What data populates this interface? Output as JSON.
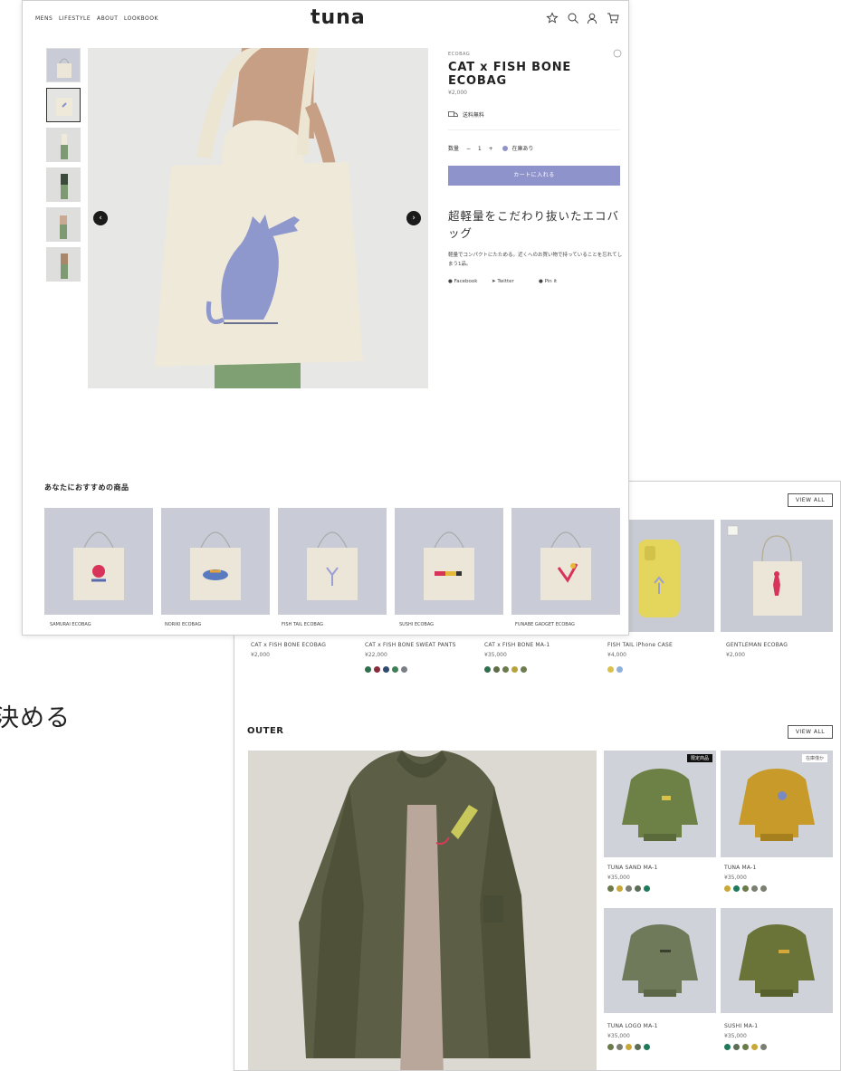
{
  "background_text": "決める",
  "front": {
    "nav": {
      "links": [
        "MENS",
        "LIFESTYLE",
        "ABOUT",
        "LOOKBOOK"
      ],
      "logo": "tuna"
    },
    "product": {
      "category": "ECOBAG",
      "title": "CAT x FISH BONE ECOBAG",
      "price": "¥2,000",
      "shipping": "送料無料",
      "qty_label": "数量",
      "qty_minus": "−",
      "qty_value": "1",
      "qty_plus": "+",
      "stock": "在庫あり",
      "cart_button": "カートに入れる",
      "headline": "超軽量をこだわり抜いたエコバッグ",
      "description": "軽量でコンパクトにたためる。近くへのお買い物で持っていることを忘れてしまう1品。",
      "share": [
        "Facebook",
        "Twitter",
        "Pin it"
      ]
    },
    "recommend": {
      "title": "あなたにおすすめの商品",
      "items": [
        "SAMURAI ECOBAG",
        "NORIKI ECOBAG",
        "FISH TAIL ECOBAG",
        "SUSHI ECOBAG",
        "FUNABE GADGET ECOBAG"
      ]
    }
  },
  "back": {
    "view_all": "VIEW ALL",
    "products": [
      {
        "name": "CAT x FISH BONE ECOBAG",
        "price": "¥2,000",
        "swatches": []
      },
      {
        "name": "CAT x FISH BONE SWEAT PANTS",
        "price": "¥22,000",
        "swatches": [
          "#2f6e4f",
          "#8a2b3a",
          "#2f4a6e",
          "#3f7f55",
          "#7a7f86"
        ]
      },
      {
        "name": "CAT x FISH BONE MA-1",
        "price": "¥35,000",
        "swatches": [
          "#2f6e4f",
          "#5d6d45",
          "#6b7a4a",
          "#b8a23a",
          "#6e7d50"
        ]
      },
      {
        "name": "FISH TAIL iPhone CASE",
        "price": "¥4,000",
        "swatches": [
          "#d8c24a",
          "#8fb0d8"
        ]
      },
      {
        "name": "GENTLEMAN ECOBAG",
        "price": "¥2,000",
        "swatches": []
      }
    ],
    "outer": {
      "title": "OUTER",
      "view_all": "VIEW ALL",
      "items": [
        {
          "name": "TUNA SAND MA-1",
          "price": "¥35,000",
          "tag": "限定商品",
          "swatches": [
            "#6b7a4a",
            "#c8a838",
            "#7a7f72",
            "#5b6d55",
            "#1e7a5a"
          ]
        },
        {
          "name": "TUNA MA-1",
          "price": "¥35,000",
          "tag": "在庫僅か",
          "swatches": [
            "#c8a838",
            "#1e7a5a",
            "#6b7a4a",
            "#7a7f72",
            "#7a7f72"
          ]
        },
        {
          "name": "TUNA LOGO MA-1",
          "price": "¥35,000",
          "tag": "",
          "swatches": [
            "#6b7a4a",
            "#7a7f72",
            "#c8a838",
            "#5b6d55",
            "#1e7a5a"
          ]
        },
        {
          "name": "SUSHI MA-1",
          "price": "¥35,000",
          "tag": "",
          "swatches": [
            "#1e7a5a",
            "#5b6d55",
            "#6b7a4a",
            "#c8a838",
            "#7a7f72"
          ]
        }
      ]
    }
  }
}
